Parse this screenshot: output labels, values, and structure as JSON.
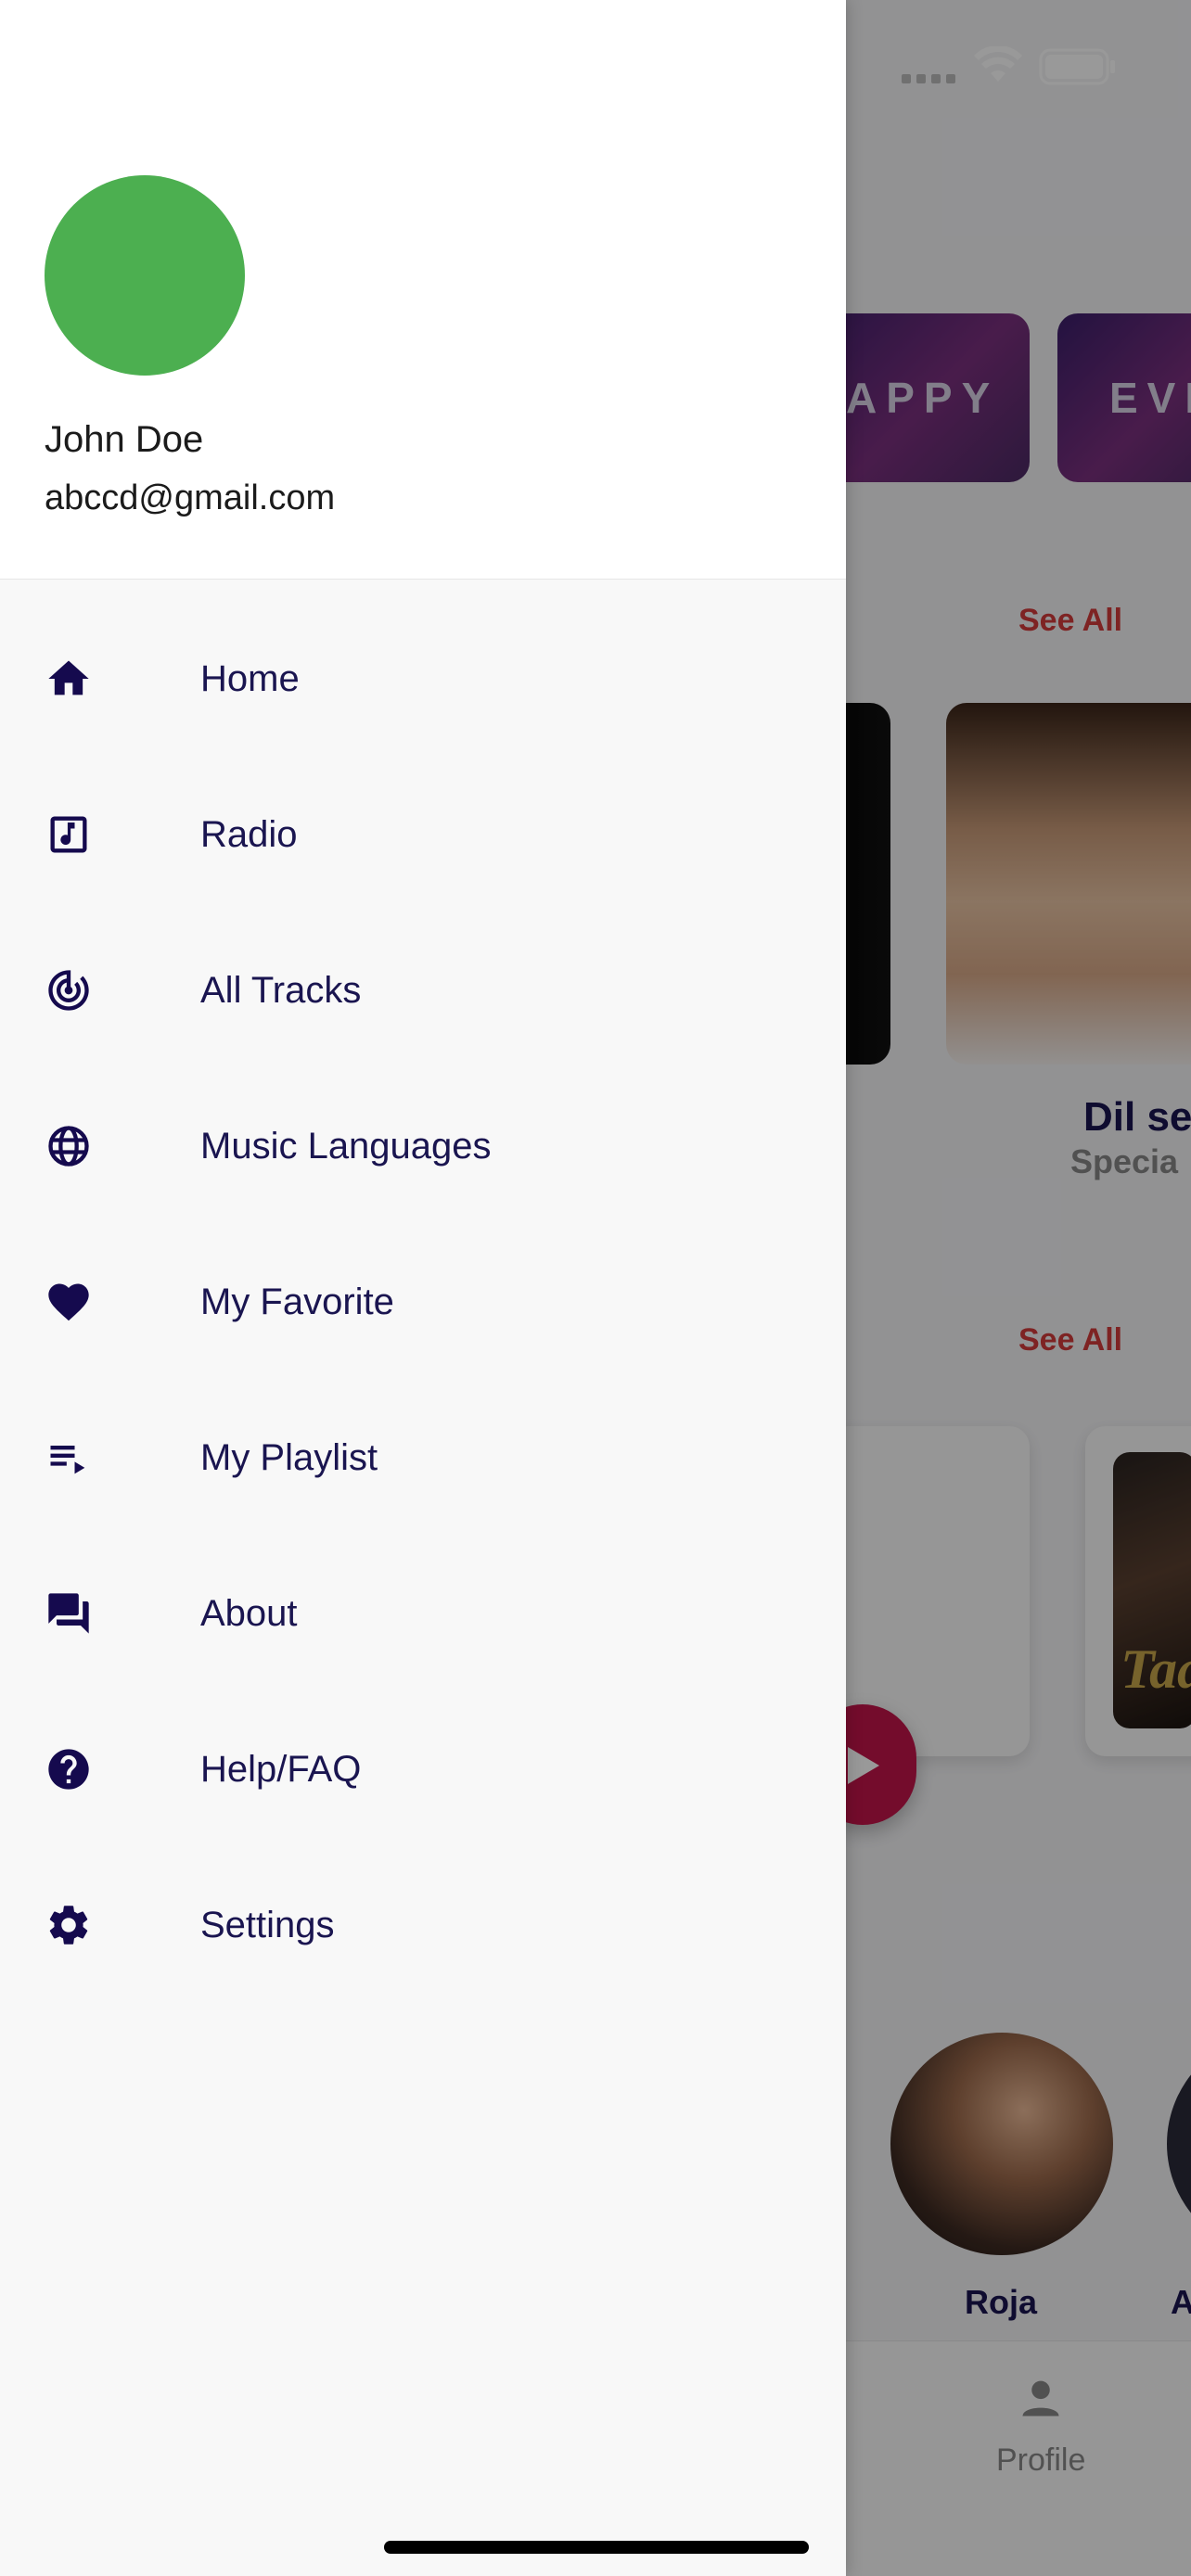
{
  "drawer": {
    "user": {
      "name": "John Doe",
      "email": "abccd@gmail.com",
      "avatar_color": "#4caf50"
    },
    "menu": [
      {
        "label": "Home",
        "icon": "home-icon"
      },
      {
        "label": "Radio",
        "icon": "music-note-icon"
      },
      {
        "label": "All Tracks",
        "icon": "track-changes-icon"
      },
      {
        "label": "Music Languages",
        "icon": "globe-icon"
      },
      {
        "label": "My Favorite",
        "icon": "heart-icon"
      },
      {
        "label": "My Playlist",
        "icon": "playlist-icon"
      },
      {
        "label": "About",
        "icon": "chat-bubbles-icon"
      },
      {
        "label": "Help/FAQ",
        "icon": "help-circle-icon"
      },
      {
        "label": "Settings",
        "icon": "gear-icon"
      }
    ],
    "icon_color": "#150a4e",
    "label_color": "#1a1550"
  },
  "background": {
    "mood_chips": [
      "APPY",
      "EVE"
    ],
    "see_all_labels": [
      "See All",
      "See All"
    ],
    "album": {
      "title": "Dil se",
      "subtitle": "Specia"
    },
    "poster_text": "Taa",
    "artists": [
      "Roja",
      "A"
    ],
    "bottom_nav": {
      "profile_label": "Profile"
    },
    "accent_color": "#d23b3b"
  }
}
